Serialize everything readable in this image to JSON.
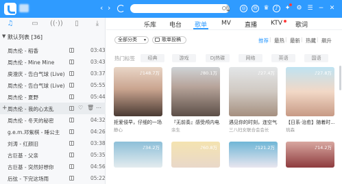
{
  "topbar": {
    "back_label": "‹",
    "forward_label": "›"
  },
  "sidebar": {
    "list_title": "默认列表 [36]",
    "songs": [
      {
        "name": "周杰伦 - 稻香",
        "duration": "03:43"
      },
      {
        "name": "周杰伦 - Mine Mine",
        "duration": "03:43"
      },
      {
        "name": "庾澄庆 - 告白气球 (Live)",
        "duration": "03:37"
      },
      {
        "name": "周杰伦 - 告白气球 (Live)",
        "duration": "05:55"
      },
      {
        "name": "周杰伦 - 夏野",
        "duration": "05:44"
      },
      {
        "name": "周杰伦 - 我的心太乱",
        "duration": ""
      },
      {
        "name": "周杰伦 - 冬天的秘密",
        "duration": "04:32"
      },
      {
        "name": "g.e.m.邓紫棋 - 睡公主",
        "duration": "04:26"
      },
      {
        "name": "刘涛 - 红颜旧",
        "duration": "03:38"
      },
      {
        "name": "古巨基 - 父亲",
        "duration": "05:35"
      },
      {
        "name": "古巨基 - 突然好想你",
        "duration": "04:56"
      },
      {
        "name": "后弦 - 下完这场雨",
        "duration": "05:22"
      }
    ]
  },
  "main": {
    "tabs": [
      "乐库",
      "电台",
      "歌单",
      "MV",
      "直播",
      "KTV",
      "歌词"
    ],
    "active_tab": "歌单",
    "filter": {
      "dropdown_label": "全部分类",
      "submit_label": "歌单投稿",
      "sort_options": [
        "推荐",
        "最热",
        "最新",
        "热藏",
        "飙升"
      ]
    },
    "tags": {
      "label": "热门标签",
      "items": [
        "经典",
        "游戏",
        "DJ热碟",
        "网络",
        "英语",
        "国语"
      ]
    },
    "cards": [
      {
        "count": "148.7万",
        "title": "拒爱侵早，仔细的一场...",
        "author": "静心"
      },
      {
        "count": "80.1万",
        "title": "『无前奏』感受颅内电...",
        "author": "余生"
      },
      {
        "count": "27.4万",
        "title": "遇见你的时刻，连空气...",
        "author": "三八妇女联合会会长"
      },
      {
        "count": "27.8万",
        "title": "【日系·治愈】随着时...",
        "author": "琉森"
      }
    ],
    "cards_row2": [
      {
        "count": "34.2万"
      },
      {
        "count": "60.8万"
      },
      {
        "count": "121.2万"
      },
      {
        "count": "14.2万"
      }
    ]
  },
  "colors": {
    "accent": "#2f9bff",
    "topbar": "#2f9bff",
    "badge": "#ff3b3b"
  }
}
